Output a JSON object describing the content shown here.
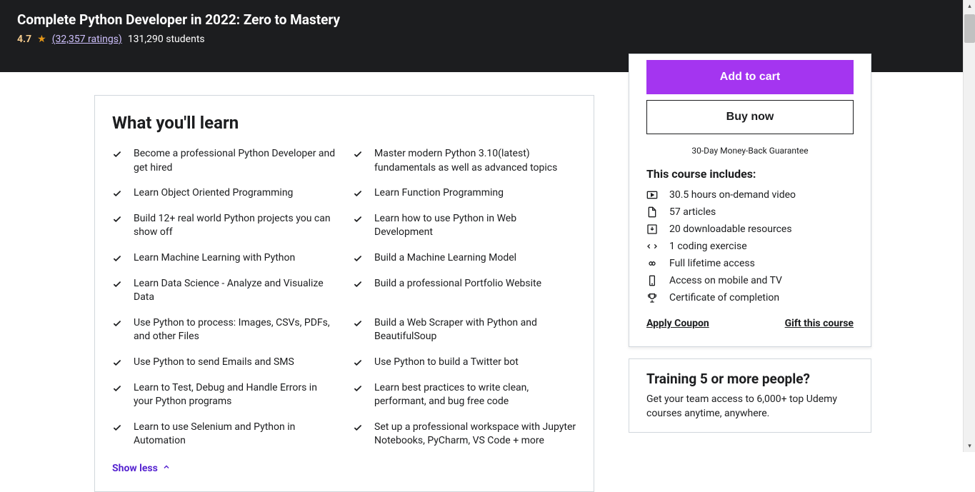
{
  "header": {
    "title": "Complete Python Developer in 2022: Zero to Mastery",
    "rating": "4.7",
    "ratings_link": "(32,357 ratings)",
    "students": "131,290 students"
  },
  "wyl": {
    "title": "What you'll learn",
    "items_left": [
      "Become a professional Python Developer and get hired",
      "Learn Object Oriented Programming",
      "Build 12+ real world Python projects you can show off",
      "Learn Machine Learning with Python",
      "Learn Data Science - Analyze and Visualize Data",
      "Use Python to process: Images, CSVs, PDFs, and other Files",
      "Use Python to send Emails and SMS",
      "Learn to Test, Debug and Handle Errors in your Python programs",
      "Learn to use Selenium and Python in Automation"
    ],
    "items_right": [
      "Master modern Python 3.10(latest) fundamentals as well as advanced topics",
      "Learn Function Programming",
      "Learn how to use Python in Web Development",
      "Build a Machine Learning Model",
      "Build a professional Portfolio Website",
      "Build a Web Scraper with Python and BeautifulSoup",
      "Use Python to build a Twitter bot",
      "Learn best practices to write clean, performant, and bug free code",
      "Set up a professional workspace with Jupyter Notebooks, PyCharm, VS Code + more"
    ],
    "show_less": "Show less"
  },
  "purchase": {
    "add_to_cart": "Add to cart",
    "buy_now": "Buy now",
    "guarantee": "30-Day Money-Back Guarantee",
    "includes_title": "This course includes:",
    "includes": [
      "30.5 hours on-demand video",
      "57 articles",
      "20 downloadable resources",
      "1 coding exercise",
      "Full lifetime access",
      "Access on mobile and TV",
      "Certificate of completion"
    ],
    "apply_coupon": "Apply Coupon",
    "gift_course": "Gift this course"
  },
  "team": {
    "title": "Training 5 or more people?",
    "desc": "Get your team access to 6,000+ top Udemy courses anytime, anywhere."
  }
}
